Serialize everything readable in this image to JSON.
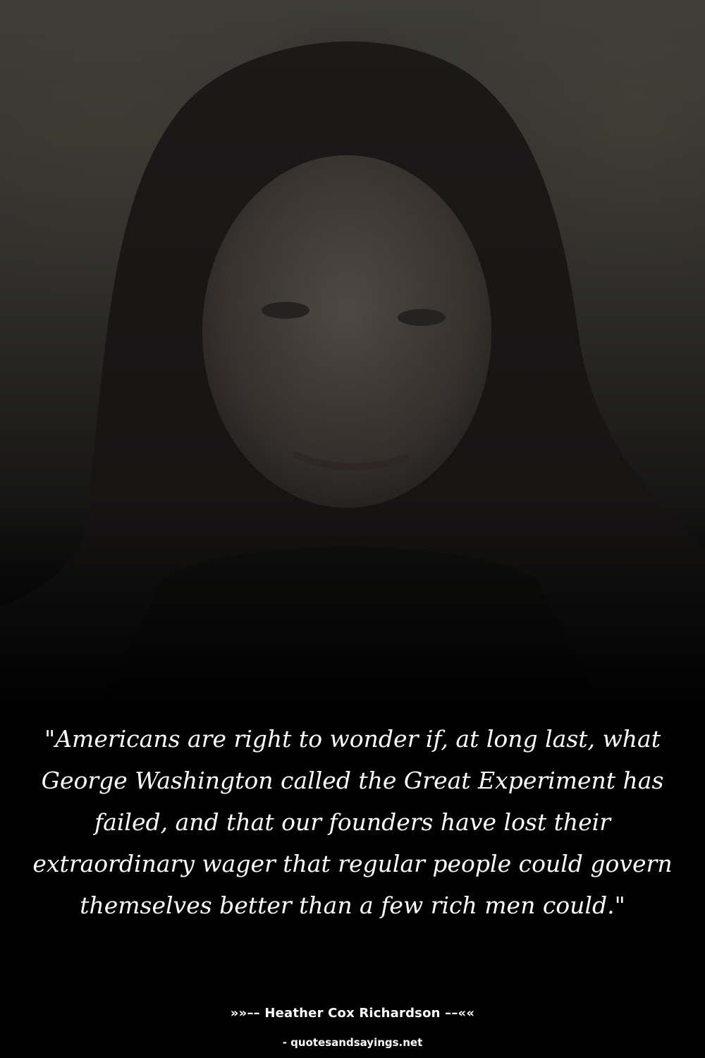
{
  "photo": {
    "subject": "portrait of a woman with long dark hair",
    "tone": "darkened overlay"
  },
  "quote": {
    "text": "\"Americans are right to wonder if, at long last, what George Washington called the Great Experiment has failed, and that our founders have lost their extraordinary wager that regular people could govern themselves better than a few rich men could.\""
  },
  "attribution": {
    "author": "»»–– Heather Cox Richardson ––««",
    "source": "- quotesandsayings.net"
  },
  "colors": {
    "background": "#000000",
    "text": "#ffffff"
  }
}
